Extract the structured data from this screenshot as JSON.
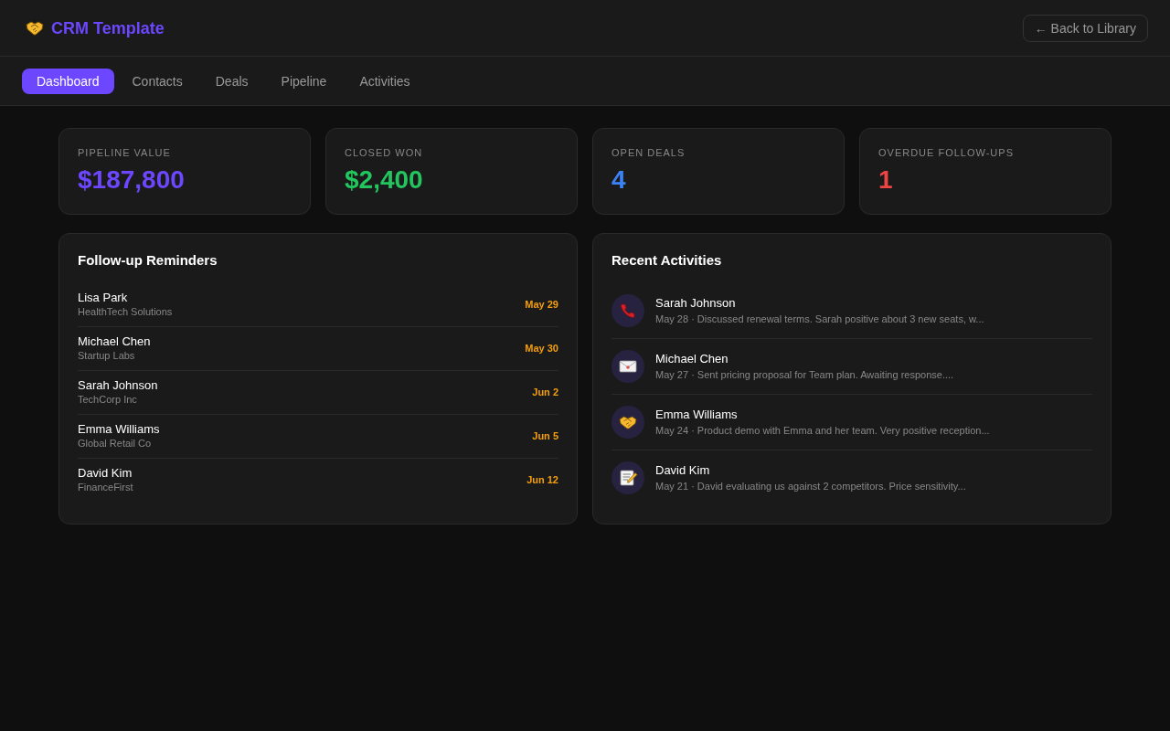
{
  "header": {
    "logo_text": "CRM Template",
    "back_button": "← Back to Library"
  },
  "tabs": [
    {
      "label": "Dashboard",
      "selected": true
    },
    {
      "label": "Contacts",
      "selected": false
    },
    {
      "label": "Deals",
      "selected": false
    },
    {
      "label": "Pipeline",
      "selected": false
    },
    {
      "label": "Activities",
      "selected": false
    }
  ],
  "stats": [
    {
      "label": "PIPELINE VALUE",
      "value": "$187,800",
      "color": "#6c47ff"
    },
    {
      "label": "CLOSED WON",
      "value": "$2,400",
      "color": "#22c55e"
    },
    {
      "label": "OPEN DEALS",
      "value": "4",
      "color": "#3b82f6"
    },
    {
      "label": "OVERDUE FOLLOW-UPS",
      "value": "1",
      "color": "#ef4444"
    }
  ],
  "reminders": {
    "title": "Follow-up Reminders",
    "items": [
      {
        "name": "Lisa Park",
        "company": "HealthTech Solutions",
        "date": "May 29"
      },
      {
        "name": "Michael Chen",
        "company": "Startup Labs",
        "date": "May 30"
      },
      {
        "name": "Sarah Johnson",
        "company": "TechCorp Inc",
        "date": "Jun 2"
      },
      {
        "name": "Emma Williams",
        "company": "Global Retail Co",
        "date": "Jun 5"
      },
      {
        "name": "David Kim",
        "company": "FinanceFirst",
        "date": "Jun 12"
      }
    ]
  },
  "activities": {
    "title": "Recent Activities",
    "items": [
      {
        "kind": "call",
        "name": "Sarah Johnson",
        "meta": "May 28 · Discussed renewal terms. Sarah positive about 3 new seats, w..."
      },
      {
        "kind": "email",
        "name": "Michael Chen",
        "meta": "May 27 · Sent pricing proposal for Team plan. Awaiting response...."
      },
      {
        "kind": "meeting",
        "name": "Emma Williams",
        "meta": "May 24 · Product demo with Emma and her team. Very positive reception..."
      },
      {
        "kind": "note",
        "name": "David Kim",
        "meta": "May 21 · David evaluating us against 2 competitors. Price sensitivity..."
      }
    ]
  }
}
